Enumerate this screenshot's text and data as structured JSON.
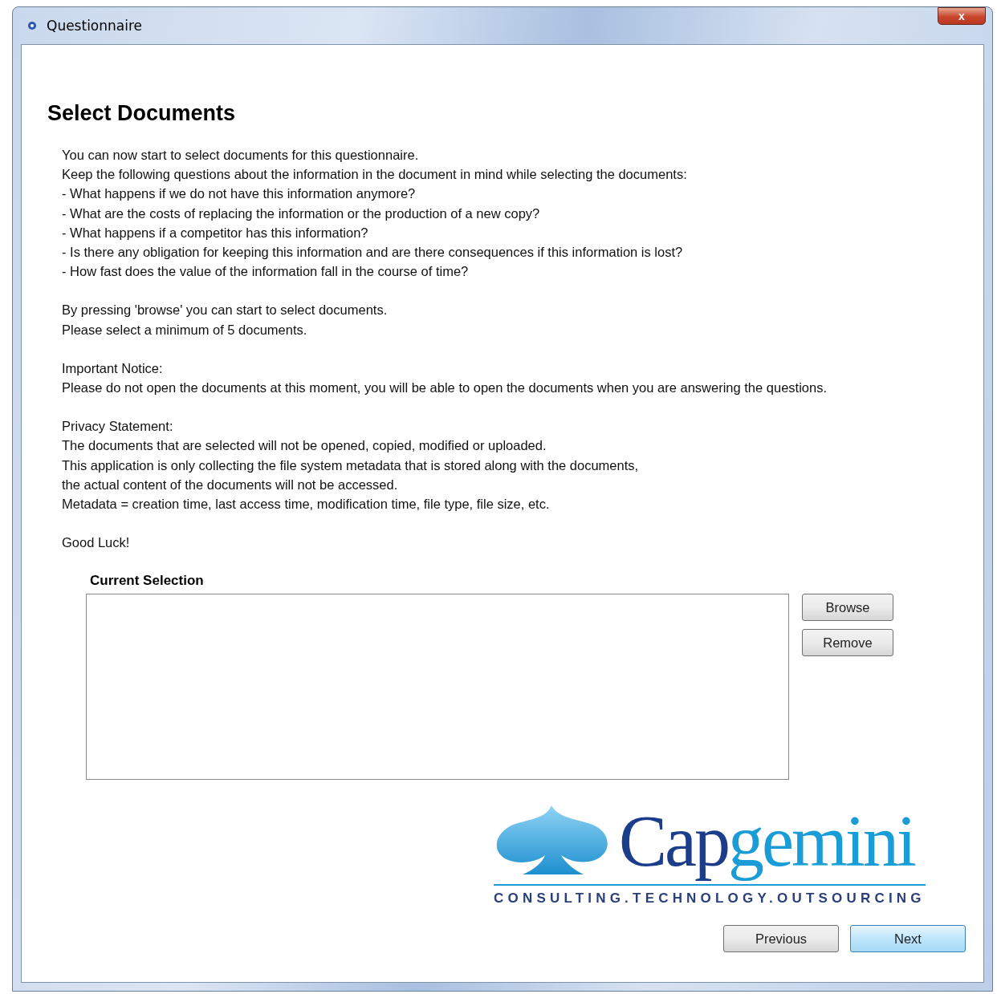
{
  "window": {
    "title": "Questionnaire",
    "close_label": "x"
  },
  "heading": "Select Documents",
  "instructions": [
    {
      "lines": [
        "You can now start to select documents for this questionnaire.",
        "Keep the following questions about the information in the document in mind while selecting the documents:",
        "- What happens if we do not have this information anymore?",
        "- What are the costs of replacing the information or the production of a new copy?",
        "- What happens if a competitor has this information?",
        "- Is there any obligation for keeping this information and are there consequences if this information is lost?",
        "- How fast does the value of the information fall in the course of time?"
      ]
    },
    {
      "lines": [
        "By pressing 'browse' you can start to select documents.",
        "Please select a minimum of 5 documents."
      ]
    },
    {
      "lines": [
        "Important Notice:",
        "Please do not open the documents at this moment, you will be able to open the documents when you are answering the questions."
      ]
    },
    {
      "lines": [
        "Privacy Statement:",
        "The documents that are selected will not be opened, copied, modified or uploaded.",
        "This application is only collecting the file system metadata that is stored along with the documents,",
        "the actual content of the documents will not be accessed.",
        "Metadata = creation time, last access time, modification time, file type, file size, etc."
      ]
    },
    {
      "lines": [
        "Good Luck!"
      ]
    }
  ],
  "selection": {
    "label": "Current Selection",
    "buttons": [
      "Browse",
      "Remove"
    ]
  },
  "logo": {
    "wordmark_dark": "Cap",
    "wordmark_light": "gemini",
    "tagline": "CONSULTING.TECHNOLOGY.OUTSOURCING"
  },
  "nav_buttons": [
    {
      "label": "Previous",
      "default": false
    },
    {
      "label": "Next",
      "default": true
    }
  ]
}
